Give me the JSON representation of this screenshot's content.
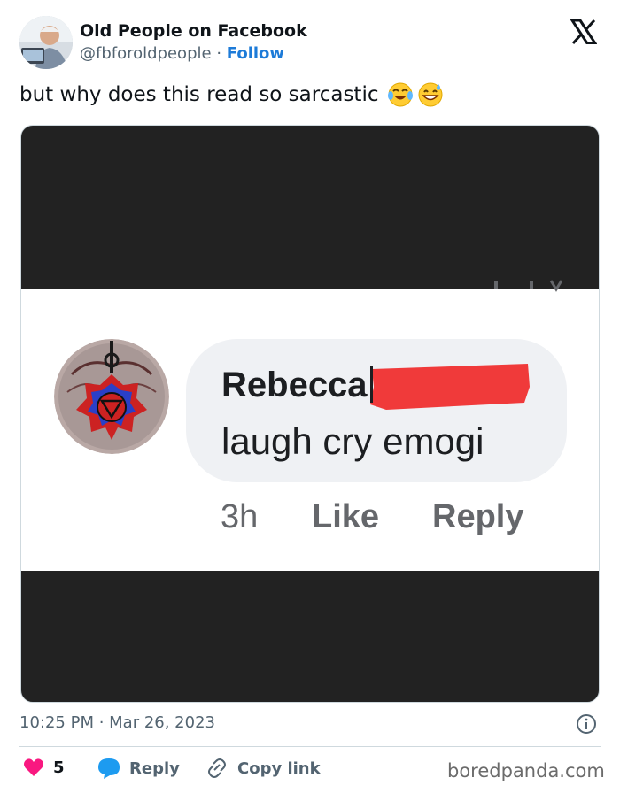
{
  "author": {
    "name": "Old People on Facebook",
    "handle": "@fbforoldpeople",
    "separator": "·",
    "follow_label": "Follow",
    "avatar_icon": "elderly-man-at-laptop-avatar"
  },
  "platform_icon": "x-logo-icon",
  "tweet": {
    "text": "but why does this read so sarcastic",
    "emojis": [
      "face-with-tears-of-joy",
      "grinning-face-with-sweat"
    ]
  },
  "media": {
    "commenter_name": "Rebecca",
    "comment_text": "laugh cry emogi",
    "time": "3h",
    "like_label": "Like",
    "reply_label": "Reply",
    "redaction_color": "#f03a3a"
  },
  "timestamp": "10:25 PM · Mar 26, 2023",
  "actions": {
    "like_count": "5",
    "reply_label": "Reply",
    "copy_label": "Copy link"
  },
  "watermark": "boredpanda.com",
  "colors": {
    "like": "#f91880",
    "reply": "#1d9bf0",
    "follow": "#1d7bd8",
    "muted": "#536471"
  }
}
